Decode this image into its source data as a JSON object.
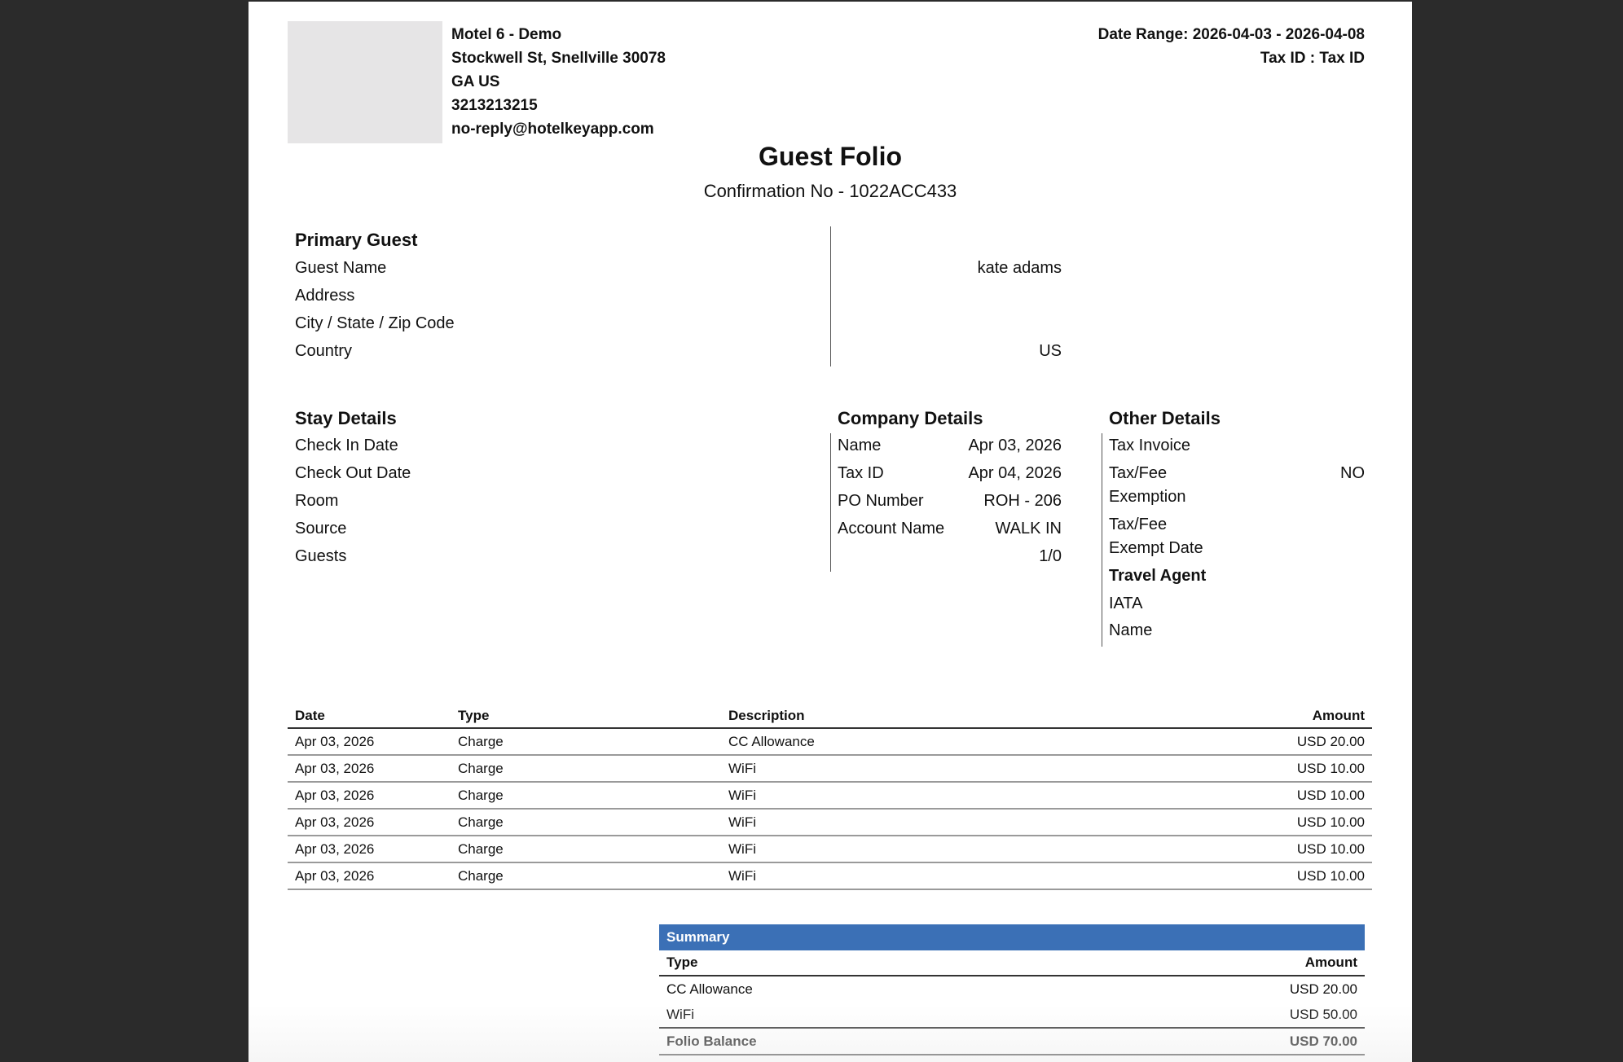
{
  "header": {
    "hotel_name": "Motel 6 - Demo",
    "street": "Stockwell St, Snellville 30078",
    "region": "GA US",
    "phone": "3213213215",
    "email": "no-reply@hotelkeyapp.com",
    "date_range": "Date Range: 2026-04-03 - 2026-04-08",
    "tax_id": "Tax ID : Tax ID"
  },
  "title": "Guest Folio",
  "confirmation": "Confirmation No - 1022ACC433",
  "primary_guest": {
    "title": "Primary Guest",
    "guest_name_label": "Guest Name",
    "guest_name": "kate adams",
    "address_label": "Address",
    "city_label": "City / State / Zip Code",
    "country_label": "Country",
    "country": "US"
  },
  "stay_details": {
    "title": "Stay Details",
    "check_in_label": "Check In Date",
    "check_in": "Apr 03, 2026",
    "check_out_label": "Check Out Date",
    "check_out": "Apr 04, 2026",
    "room_label": "Room",
    "room": "ROH - 206",
    "source_label": "Source",
    "source": "WALK IN",
    "guests_label": "Guests",
    "guests": "1/0"
  },
  "company_details": {
    "title": "Company Details",
    "name_label": "Name",
    "tax_id_label": "Tax ID",
    "po_label": "PO Number",
    "account_label": "Account Name"
  },
  "other_details": {
    "title": "Other Details",
    "tax_invoice_label": "Tax Invoice",
    "exemption_label_1": "Tax/Fee",
    "exemption_label_2": "Exemption",
    "exemption_value": "NO",
    "exempt_date_label_1": "Tax/Fee",
    "exempt_date_label_2": "Exempt Date",
    "travel_agent_title": "Travel Agent",
    "iata_label": "IATA",
    "agent_name_label": "Name"
  },
  "transactions": {
    "headers": {
      "date": "Date",
      "type": "Type",
      "description": "Description",
      "amount": "Amount"
    },
    "rows": [
      {
        "date": "Apr 03, 2026",
        "type": "Charge",
        "description": "CC Allowance",
        "amount": "USD 20.00"
      },
      {
        "date": "Apr 03, 2026",
        "type": "Charge",
        "description": "WiFi",
        "amount": "USD 10.00"
      },
      {
        "date": "Apr 03, 2026",
        "type": "Charge",
        "description": "WiFi",
        "amount": "USD 10.00"
      },
      {
        "date": "Apr 03, 2026",
        "type": "Charge",
        "description": "WiFi",
        "amount": "USD 10.00"
      },
      {
        "date": "Apr 03, 2026",
        "type": "Charge",
        "description": "WiFi",
        "amount": "USD 10.00"
      },
      {
        "date": "Apr 03, 2026",
        "type": "Charge",
        "description": "WiFi",
        "amount": "USD 10.00"
      }
    ]
  },
  "summary": {
    "title": "Summary",
    "type_header": "Type",
    "amount_header": "Amount",
    "rows": [
      {
        "type": "CC Allowance",
        "amount": "USD 20.00"
      },
      {
        "type": "WiFi",
        "amount": "USD 50.00"
      }
    ],
    "total_label": "Folio Balance",
    "total_amount": "USD 70.00"
  },
  "colors": {
    "background": "#2b2b2b",
    "page": "#ffffff",
    "summary_header": "#3b70b6",
    "logo_placeholder": "#e6e5e6"
  }
}
